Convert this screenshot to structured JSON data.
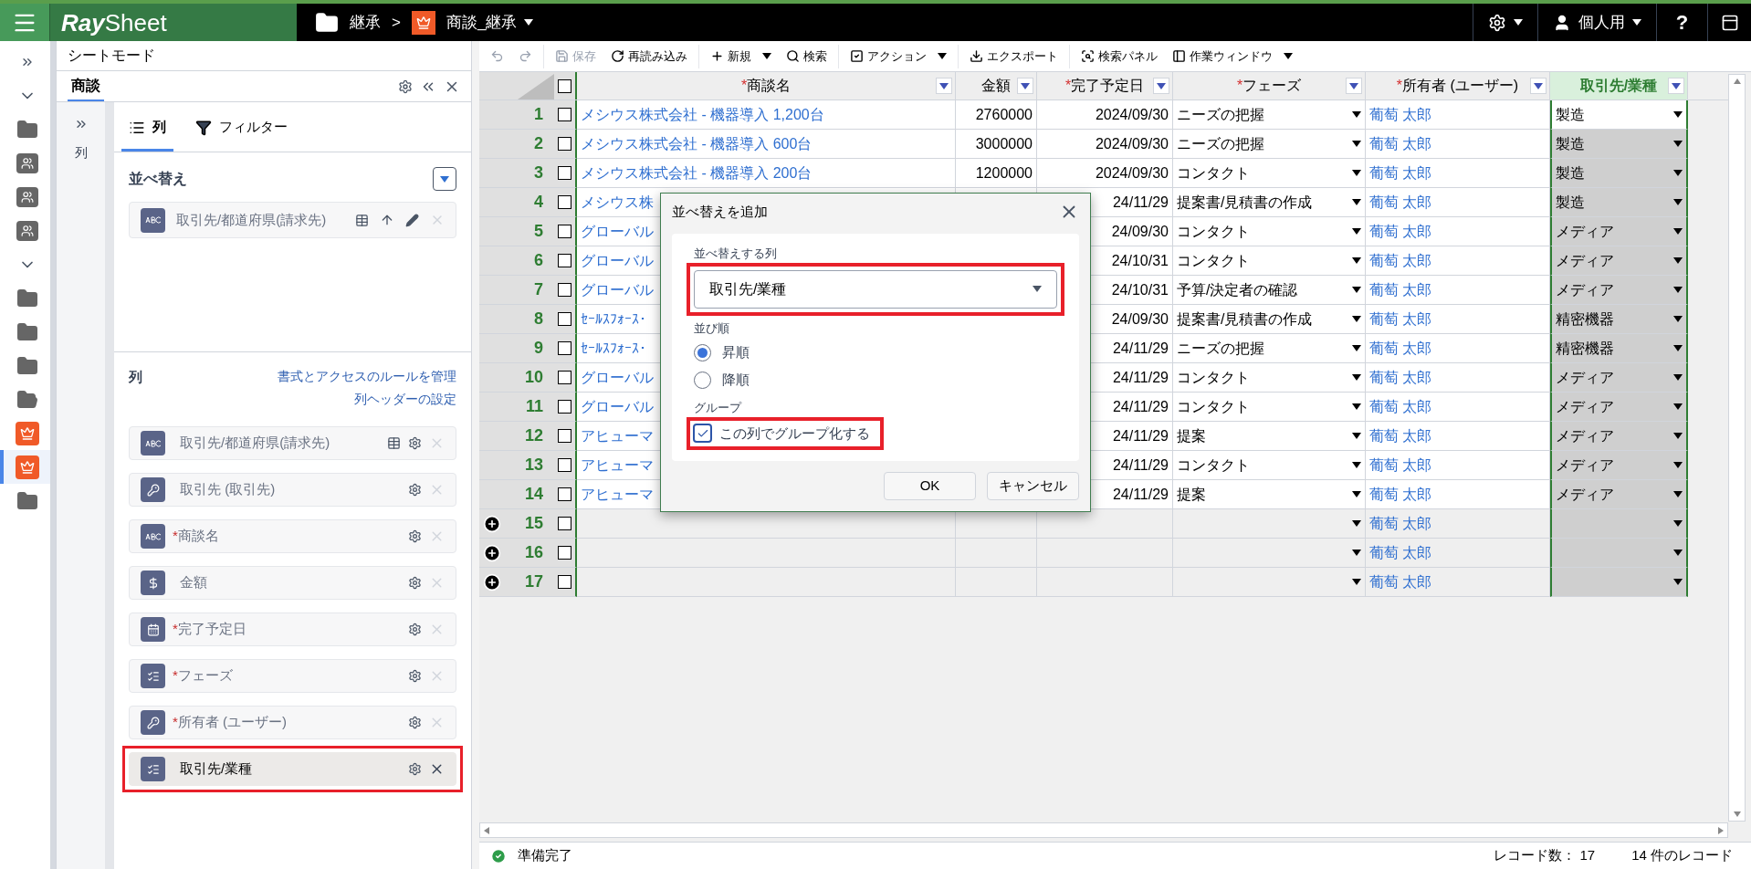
{
  "topbar": {
    "logo_bold": "Ray",
    "logo_light": "Sheet",
    "breadcrumb": [
      {
        "kind": "folder",
        "label": "継承"
      },
      {
        "kind": "app",
        "label": "商談_継承"
      }
    ],
    "separator": ">",
    "user": "個人用",
    "help": "?"
  },
  "nav": [
    {
      "kind": "expand",
      "selected": false
    },
    {
      "kind": "collapse",
      "selected": false
    },
    {
      "kind": "folder",
      "selected": false
    },
    {
      "kind": "shared-folder",
      "selected": false
    },
    {
      "kind": "shared-folder",
      "selected": false
    },
    {
      "kind": "shared-folder",
      "selected": false
    },
    {
      "kind": "collapse",
      "selected": false
    },
    {
      "kind": "folder",
      "selected": false
    },
    {
      "kind": "folder",
      "selected": false
    },
    {
      "kind": "folder",
      "selected": false
    },
    {
      "kind": "open-folder",
      "selected": false
    },
    {
      "kind": "app",
      "selected": false
    },
    {
      "kind": "app",
      "selected": true
    },
    {
      "kind": "folder",
      "selected": false
    }
  ],
  "panel": {
    "title": "シートモード",
    "tab": "商談",
    "side_label": "列",
    "tabs": [
      {
        "kind": "columns",
        "label": "列",
        "selected": true
      },
      {
        "kind": "filter",
        "label": "フィルター",
        "selected": false
      }
    ],
    "sort": {
      "heading": "並べ替え",
      "items": [
        {
          "kind": "text",
          "label": "取引先/都道府県(請求先)"
        }
      ]
    },
    "columns": {
      "heading": "列",
      "links": [
        "書式とアクセスのルールを管理",
        "列ヘッダーの設定"
      ],
      "items": [
        {
          "kind": "text",
          "label": "取引先/都道府県(請求先)",
          "lookup": true,
          "selected": false,
          "highlighted": false
        },
        {
          "kind": "key",
          "label": "取引先 (取引先)",
          "lookup": false,
          "selected": false,
          "highlighted": false
        },
        {
          "kind": "text",
          "required_mark": "*",
          "label": "商談名",
          "lookup": false,
          "selected": false,
          "highlighted": false
        },
        {
          "kind": "money",
          "label": "金額",
          "lookup": false,
          "selected": false,
          "highlighted": false
        },
        {
          "kind": "date",
          "required_mark": "*",
          "label": "完了予定日",
          "lookup": false,
          "selected": false,
          "highlighted": false
        },
        {
          "kind": "list",
          "required_mark": "*",
          "label": "フェーズ",
          "lookup": false,
          "selected": false,
          "highlighted": false
        },
        {
          "kind": "key",
          "required_mark": "*",
          "label": "所有者 (ユーザー)",
          "lookup": false,
          "selected": false,
          "highlighted": false
        },
        {
          "kind": "list",
          "label": "取引先/業種",
          "lookup": false,
          "selected": true,
          "highlighted": true
        }
      ]
    }
  },
  "toolbar": [
    {
      "kind": "undo",
      "disabled": true
    },
    {
      "kind": "redo",
      "disabled": true
    },
    {
      "kind": "save",
      "label": "保存",
      "disabled": true
    },
    {
      "kind": "reload",
      "label": "再読み込み",
      "disabled": false
    },
    {
      "kind": "new",
      "label": "新規",
      "disabled": false
    },
    {
      "kind": "search",
      "label": "検索",
      "disabled": false
    },
    {
      "kind": "action",
      "label": "アクション",
      "disabled": false
    },
    {
      "kind": "export",
      "label": "エクスポート",
      "disabled": false
    },
    {
      "kind": "search-panel",
      "label": "検索パネル",
      "disabled": false
    },
    {
      "kind": "work-window",
      "label": "作業ウィンドウ",
      "disabled": false
    }
  ],
  "grid": {
    "select_all_checked": false,
    "columns": [
      {
        "required_mark": "*",
        "label": "商談名",
        "selected": false
      },
      {
        "label": "金額",
        "selected": false
      },
      {
        "required_mark": "*",
        "label": "完了予定日",
        "selected": false
      },
      {
        "required_mark": "*",
        "label": "フェーズ",
        "selected": false
      },
      {
        "required_mark": "*",
        "label": "所有者 (ユーザー)",
        "selected": false
      },
      {
        "label": "取引先/業種",
        "selected": true
      }
    ],
    "rows": [
      {
        "no": "1",
        "new": false,
        "checked": false,
        "selected": true,
        "name": "メシウス株式会社 - 機器導入 1,200台",
        "amount": "2760000",
        "date": "2024/09/30",
        "phase": "ニーズの把握",
        "owner": "葡萄 太郎",
        "industry": "製造"
      },
      {
        "no": "2",
        "new": false,
        "checked": false,
        "selected": false,
        "name": "メシウス株式会社 - 機器導入 600台",
        "amount": "3000000",
        "date": "2024/09/30",
        "phase": "ニーズの把握",
        "owner": "葡萄 太郎",
        "industry": "製造"
      },
      {
        "no": "3",
        "new": false,
        "checked": false,
        "selected": false,
        "name": "メシウス株式会社 - 機器導入 200台",
        "amount": "1200000",
        "date": "2024/09/30",
        "phase": "コンタクト",
        "owner": "葡萄 太郎",
        "industry": "製造"
      },
      {
        "no": "4",
        "new": false,
        "checked": false,
        "selected": false,
        "name": "メシウス株",
        "date": "24/11/29",
        "phase": "提案書/見積書の作成",
        "owner": "葡萄 太郎",
        "industry": "製造"
      },
      {
        "no": "5",
        "new": false,
        "checked": false,
        "selected": false,
        "name": "グローバル",
        "date": "24/09/30",
        "phase": "コンタクト",
        "owner": "葡萄 太郎",
        "industry": "メディア"
      },
      {
        "no": "6",
        "new": false,
        "checked": false,
        "selected": false,
        "name": "グローバル",
        "date": "24/10/31",
        "phase": "コンタクト",
        "owner": "葡萄 太郎",
        "industry": "メディア"
      },
      {
        "no": "7",
        "new": false,
        "checked": false,
        "selected": false,
        "name": "グローバル",
        "date": "24/10/31",
        "phase": "予算/決定者の確認",
        "owner": "葡萄 太郎",
        "industry": "メディア"
      },
      {
        "no": "8",
        "new": false,
        "checked": false,
        "selected": false,
        "name": "ｾｰﾙｽﾌｫｰｽ･",
        "date": "24/09/30",
        "phase": "提案書/見積書の作成",
        "owner": "葡萄 太郎",
        "industry": "精密機器"
      },
      {
        "no": "9",
        "new": false,
        "checked": false,
        "selected": false,
        "name": "ｾｰﾙｽﾌｫｰｽ･",
        "date": "24/11/29",
        "phase": "ニーズの把握",
        "owner": "葡萄 太郎",
        "industry": "精密機器"
      },
      {
        "no": "10",
        "new": false,
        "checked": false,
        "selected": false,
        "name": "グローバル",
        "date": "24/11/29",
        "phase": "コンタクト",
        "owner": "葡萄 太郎",
        "industry": "メディア"
      },
      {
        "no": "11",
        "new": false,
        "checked": false,
        "selected": false,
        "name": "グローバル",
        "date": "24/11/29",
        "phase": "コンタクト",
        "owner": "葡萄 太郎",
        "industry": "メディア"
      },
      {
        "no": "12",
        "new": false,
        "checked": false,
        "selected": false,
        "name": "アヒューマ",
        "date": "24/11/29",
        "phase": "提案",
        "owner": "葡萄 太郎",
        "industry": "メディア"
      },
      {
        "no": "13",
        "new": false,
        "checked": false,
        "selected": false,
        "name": "アヒューマ",
        "date": "24/11/29",
        "phase": "コンタクト",
        "owner": "葡萄 太郎",
        "industry": "メディア"
      },
      {
        "no": "14",
        "new": false,
        "checked": false,
        "selected": false,
        "name": "アヒューマ",
        "date": "24/11/29",
        "phase": "提案",
        "owner": "葡萄 太郎",
        "industry": "メディア"
      },
      {
        "no": "15",
        "new": true,
        "checked": false,
        "selected": false,
        "owner": "葡萄 太郎"
      },
      {
        "no": "16",
        "new": true,
        "checked": false,
        "selected": false,
        "owner": "葡萄 太郎"
      },
      {
        "no": "17",
        "new": true,
        "checked": false,
        "selected": false,
        "owner": "葡萄 太郎"
      }
    ]
  },
  "dialog": {
    "title": "並べ替えを追加",
    "field_label": "並べ替えする列",
    "field_value": "取引先/業種",
    "field_highlighted": true,
    "order_label": "並び順",
    "orders": [
      {
        "label": "昇順",
        "selected": true
      },
      {
        "label": "降順",
        "selected": false
      }
    ],
    "group_label": "グループ",
    "group": {
      "label": "この列でグループ化する",
      "checked": true,
      "highlighted": true
    },
    "buttons": [
      "OK",
      "キャンセル"
    ]
  },
  "status": {
    "text": "準備完了",
    "count": "レコード数： 17",
    "records": "14 件のレコード"
  }
}
